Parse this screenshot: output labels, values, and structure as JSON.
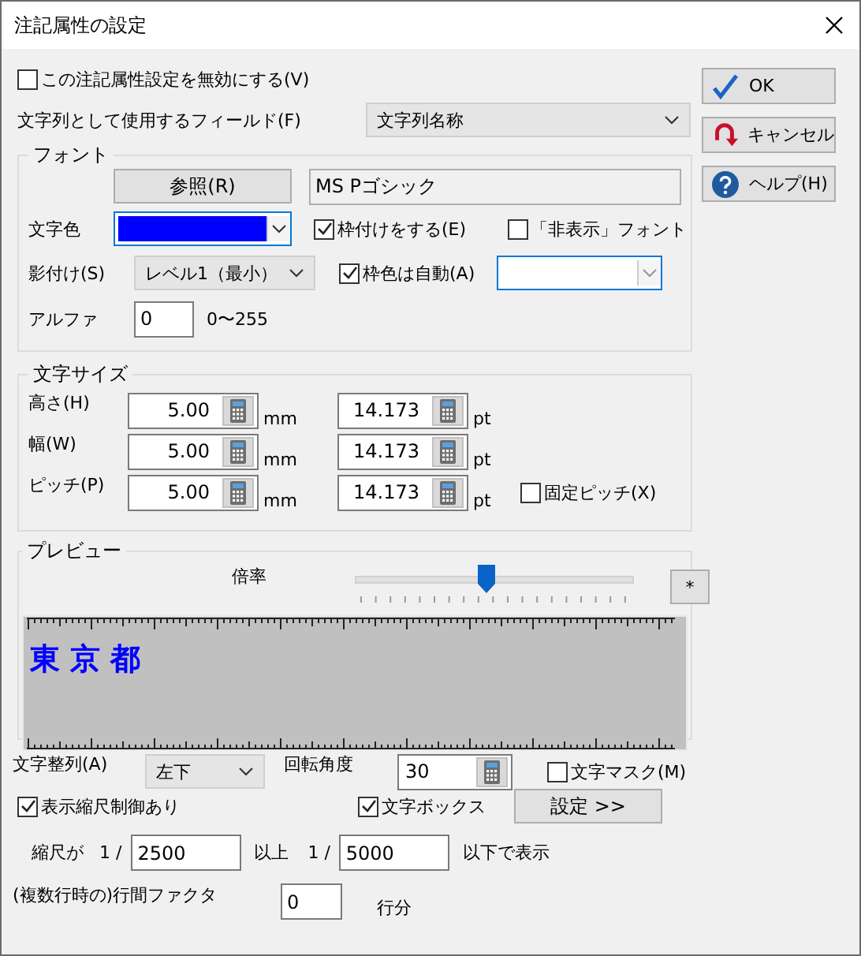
{
  "window": {
    "title": "注記属性の設定"
  },
  "disable_setting": {
    "label": "この注記属性設定を無効にする(V)",
    "checked": false
  },
  "field": {
    "label": "文字列として使用するフィールド(F)",
    "value": "文字列名称"
  },
  "font_group": {
    "legend": "フォント",
    "browse_button": "参照(R)",
    "font_name": "MS Pゴシック",
    "color_label": "文字色",
    "text_color": {
      "color": "#0000ff"
    },
    "outline": {
      "label": "枠付けをする(E)",
      "checked": true
    },
    "hidden_font": {
      "label": "「非表示」フォント",
      "checked": false
    },
    "shadow_label": "影付け(S)",
    "shadow_value": "レベル1（最小）",
    "auto_outline_color": {
      "label": "枠色は自動(A)",
      "checked": true
    },
    "alpha_label": "アルファ",
    "alpha_value": "0",
    "alpha_range": "0〜255"
  },
  "size_group": {
    "legend": "文字サイズ",
    "rows": [
      {
        "label": "高さ(H)",
        "mm": "5.00",
        "mm_unit": "mm",
        "pt": "14.173",
        "pt_unit": "pt"
      },
      {
        "label": "幅(W)",
        "mm": "5.00",
        "mm_unit": "mm",
        "pt": "14.173",
        "pt_unit": "pt"
      },
      {
        "label": "ピッチ(P)",
        "mm": "5.00",
        "mm_unit": "mm",
        "pt": "14.173",
        "pt_unit": "pt"
      }
    ],
    "fixed_pitch": {
      "label": "固定ピッチ(X)",
      "checked": false
    }
  },
  "preview": {
    "legend": "プレビュー",
    "zoom_label": "倍率",
    "level": 0.47,
    "reset_button": "*",
    "sample_text": "東 京 都"
  },
  "alignment": {
    "label": "文字整列(A)",
    "value": "左下"
  },
  "rotation": {
    "label": "回転角度",
    "value": "30"
  },
  "text_mask": {
    "label": "文字マスク(M)",
    "checked": false
  },
  "text_box": {
    "label": "文字ボックス",
    "checked": true
  },
  "settings_button": "設定 >>",
  "scale_control": {
    "label": "表示縮尺制御あり",
    "checked": true
  },
  "scale_range": {
    "prefix": "縮尺が",
    "ratio_a": "1 /",
    "min": "2500",
    "between": "以上",
    "ratio_b": "1 /",
    "max": "5000",
    "suffix": "以下で表示"
  },
  "line_spacing": {
    "label": "(複数行時の)行間ファクタ",
    "value": "0",
    "unit": "行分"
  },
  "buttons": [
    {
      "kind": "ok",
      "label": "OK"
    },
    {
      "kind": "cancel",
      "label": "キャンセル"
    },
    {
      "kind": "help",
      "label": "ヘルプ(H)"
    }
  ]
}
